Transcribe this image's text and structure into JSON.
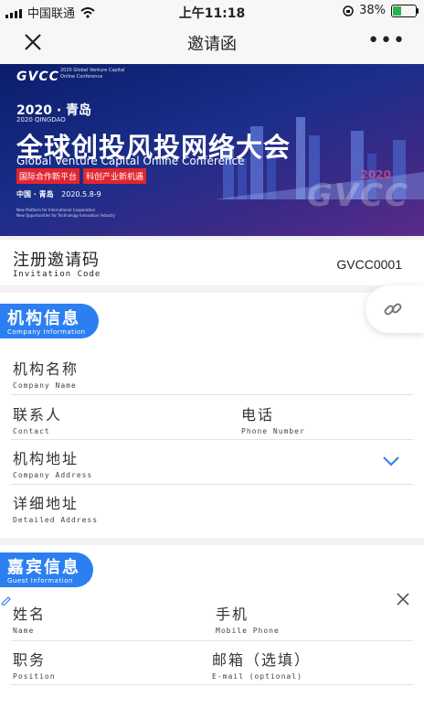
{
  "status_bar": {
    "carrier": "中国联通",
    "time": "上午11:18",
    "battery": "38%"
  },
  "nav": {
    "title": "邀请函",
    "more": "•••"
  },
  "banner": {
    "logo": "GVCC",
    "logo_sub_1": "2020 Global Venture Capital",
    "logo_sub_2": "Online Conference",
    "year_cn": "2020 · 青岛",
    "year_en": "2020 QINGDAO",
    "title_cn": "全球创投风投网络大会",
    "title_en": "Global Venture Capital Online Conference",
    "tags": [
      "国际合作新平台",
      "科创产业新机遇"
    ],
    "location": "中国 · 青岛",
    "dates": "2020.5.8-9",
    "tagline_1": "New Platform for International Cooperation",
    "tagline_2": "New Opportunities for Technology Innovation Industry",
    "watermark": "GVCC",
    "watermark_year": "2020"
  },
  "invitation": {
    "label_cn": "注册邀请码",
    "label_en": "Invitation Code",
    "value": "GVCC0001"
  },
  "company": {
    "badge_cn": "机构信息",
    "badge_en": "Company Information",
    "fields": {
      "name": {
        "cn": "机构名称",
        "en": "Company Name"
      },
      "contact": {
        "cn": "联系人",
        "en": "Contact"
      },
      "phone": {
        "cn": "电话",
        "en": "Phone Number"
      },
      "address": {
        "cn": "机构地址",
        "en": "Company Address"
      },
      "detailed": {
        "cn": "详细地址",
        "en": "Detailed Address"
      }
    }
  },
  "guest": {
    "badge_cn": "嘉宾信息",
    "badge_en": "Guest Information",
    "fields": {
      "name": {
        "cn": "姓名",
        "en": "Name"
      },
      "mobile": {
        "cn": "手机",
        "en": "Mobile Phone"
      },
      "position": {
        "cn": "职务",
        "en": "Position"
      },
      "email": {
        "cn": "邮箱（选填）",
        "en": "E-mail (optional)"
      }
    }
  },
  "icons": {
    "close": "close-icon",
    "more": "more-icon",
    "link": "link-icon",
    "chevron": "chevron-down-icon",
    "delete": "delete-icon"
  },
  "colors": {
    "accent": "#2b7ff0",
    "banner_dark": "#0b1d6b",
    "tag_red": "#e2252f"
  }
}
